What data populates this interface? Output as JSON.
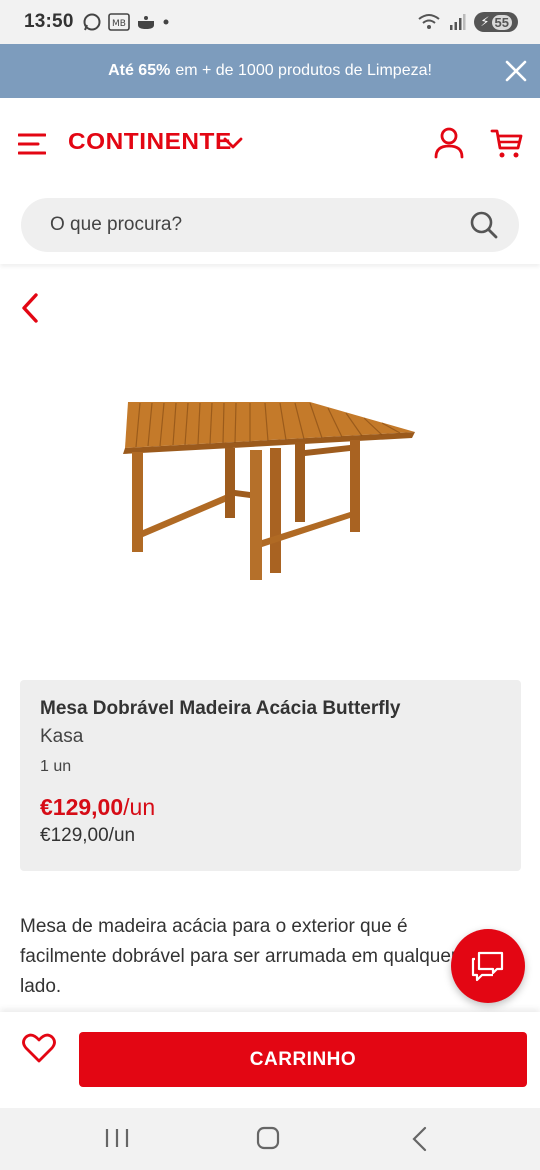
{
  "status_bar": {
    "time": "13:50",
    "battery": "55",
    "icons": [
      "whatsapp-icon",
      "multibanco-icon",
      "cooking-pot-icon",
      "dot-icon",
      "wifi-icon",
      "signal-icon",
      "battery-icon"
    ]
  },
  "promo": {
    "highlight": "Até 65%",
    "text": "em + de 1000 produtos de Limpeza!"
  },
  "header": {
    "brand": "CONTINENTE"
  },
  "search": {
    "placeholder": "O que procura?"
  },
  "product": {
    "title": "Mesa Dobrável Madeira Acácia Butterfly",
    "brand": "Kasa",
    "quantity": "1 un",
    "price": "€129,00",
    "price_suffix": "/un",
    "unit_price": "€129,00/un",
    "description": "Mesa de madeira acácia para o exterior que é facilmente dobrável para ser arrumada em qualquer lado."
  },
  "actions": {
    "cart_label": "CARRINHO"
  },
  "colors": {
    "brand_red": "#e30613",
    "promo_bg": "#7d9cbd",
    "card_bg": "#eeeeee",
    "price_red": "#d60c16"
  }
}
